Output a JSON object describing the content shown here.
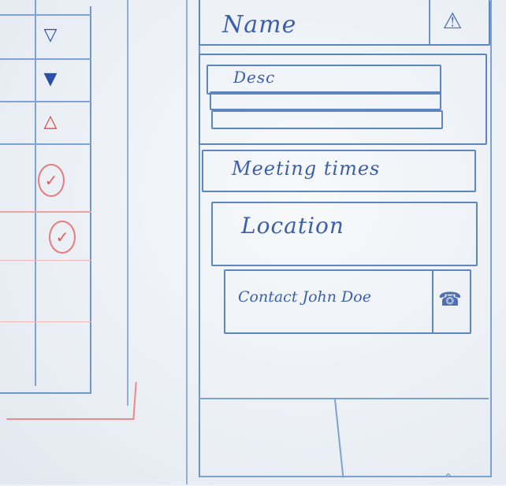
{
  "left_panel": {
    "status_marks": [
      {
        "glyph": "▽",
        "color": "blue",
        "icon": "down-triangle-icon"
      },
      {
        "glyph": "▼",
        "color": "blue",
        "icon": "down-triangle-filled-icon"
      },
      {
        "glyph": "△",
        "color": "red",
        "icon": "warning-icon"
      },
      {
        "glyph": "✓",
        "color": "red",
        "icon": "check-circle-icon"
      },
      {
        "glyph": "✓",
        "color": "red",
        "icon": "check-circle-icon"
      }
    ]
  },
  "detail": {
    "name_label": "Name",
    "name_icon": "warning-icon",
    "name_icon_glyph": "⚠",
    "desc_label": "Desc",
    "meeting_label": "Meeting times",
    "location_label": "Location",
    "contact_label": "Contact John Doe",
    "contact_icon": "phone-icon",
    "contact_icon_glyph": "☎"
  },
  "colors": {
    "ink_blue": "#3b5fa8",
    "ink_red": "#d63e3e",
    "paper": "#eef2f6"
  }
}
